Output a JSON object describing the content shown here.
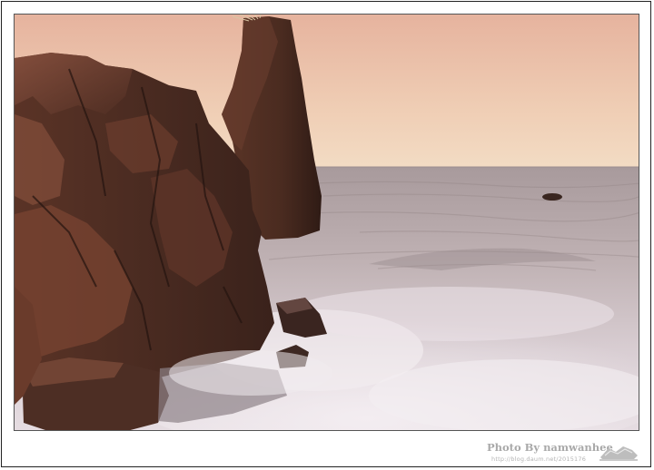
{
  "watermark": {
    "credit": "Photo By namwanhee",
    "url": "http://blog.daum.net/2015176"
  },
  "photo": {
    "colors": {
      "sky_top": "#e9b8a0",
      "sky_bottom": "#f2d9bf",
      "sea": "#cfc2c4",
      "rock": "#4a2c22",
      "foam": "#ede6ea"
    }
  }
}
